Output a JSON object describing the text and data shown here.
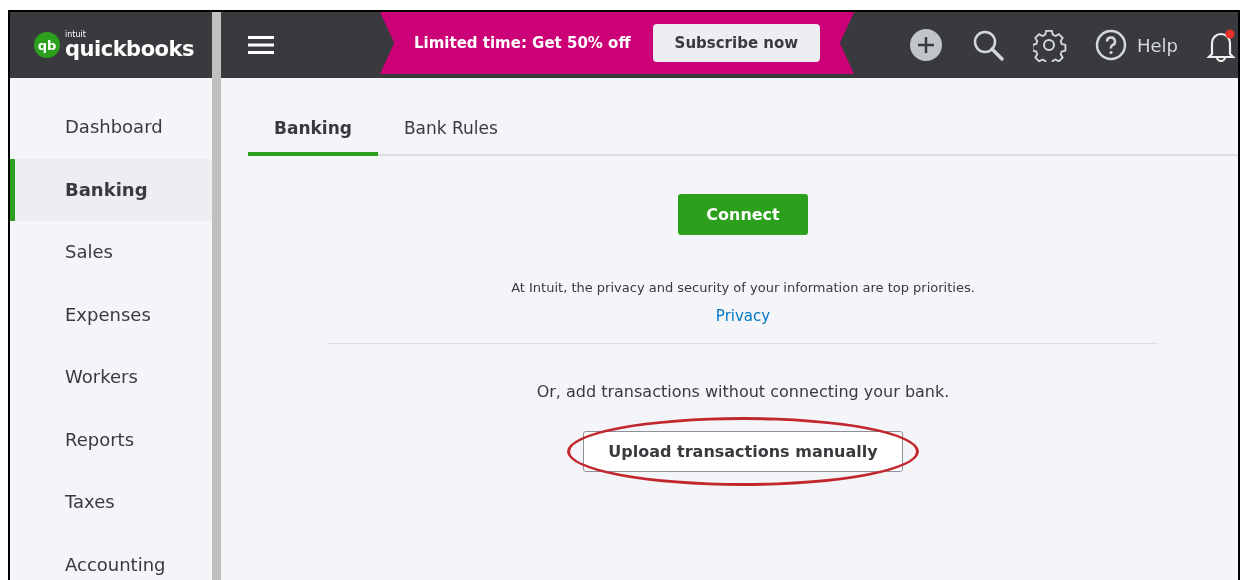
{
  "logo": {
    "mark": "qb",
    "brand": "intuit",
    "name": "quickbooks"
  },
  "promo": {
    "text": "Limited time: Get 50% off",
    "button": "Subscribe now"
  },
  "toolbar": {
    "help": "Help",
    "notification": true
  },
  "sidebar": {
    "items": [
      {
        "label": "Dashboard",
        "selected": false
      },
      {
        "label": "Banking",
        "selected": true
      },
      {
        "label": "Sales",
        "selected": false
      },
      {
        "label": "Expenses",
        "selected": false
      },
      {
        "label": "Workers",
        "selected": false
      },
      {
        "label": "Reports",
        "selected": false
      },
      {
        "label": "Taxes",
        "selected": false
      },
      {
        "label": "Accounting",
        "selected": false
      }
    ]
  },
  "tabs": [
    {
      "label": "Banking",
      "selected": true
    },
    {
      "label": "Bank Rules",
      "selected": false
    }
  ],
  "connect": {
    "button": "Connect",
    "privacy_note": "At Intuit, the privacy and security of your information are top priorities.",
    "privacy_link": "Privacy"
  },
  "manual": {
    "note": "Or, add transactions without connecting your bank.",
    "button": "Upload transactions manually",
    "highlighted": true
  }
}
